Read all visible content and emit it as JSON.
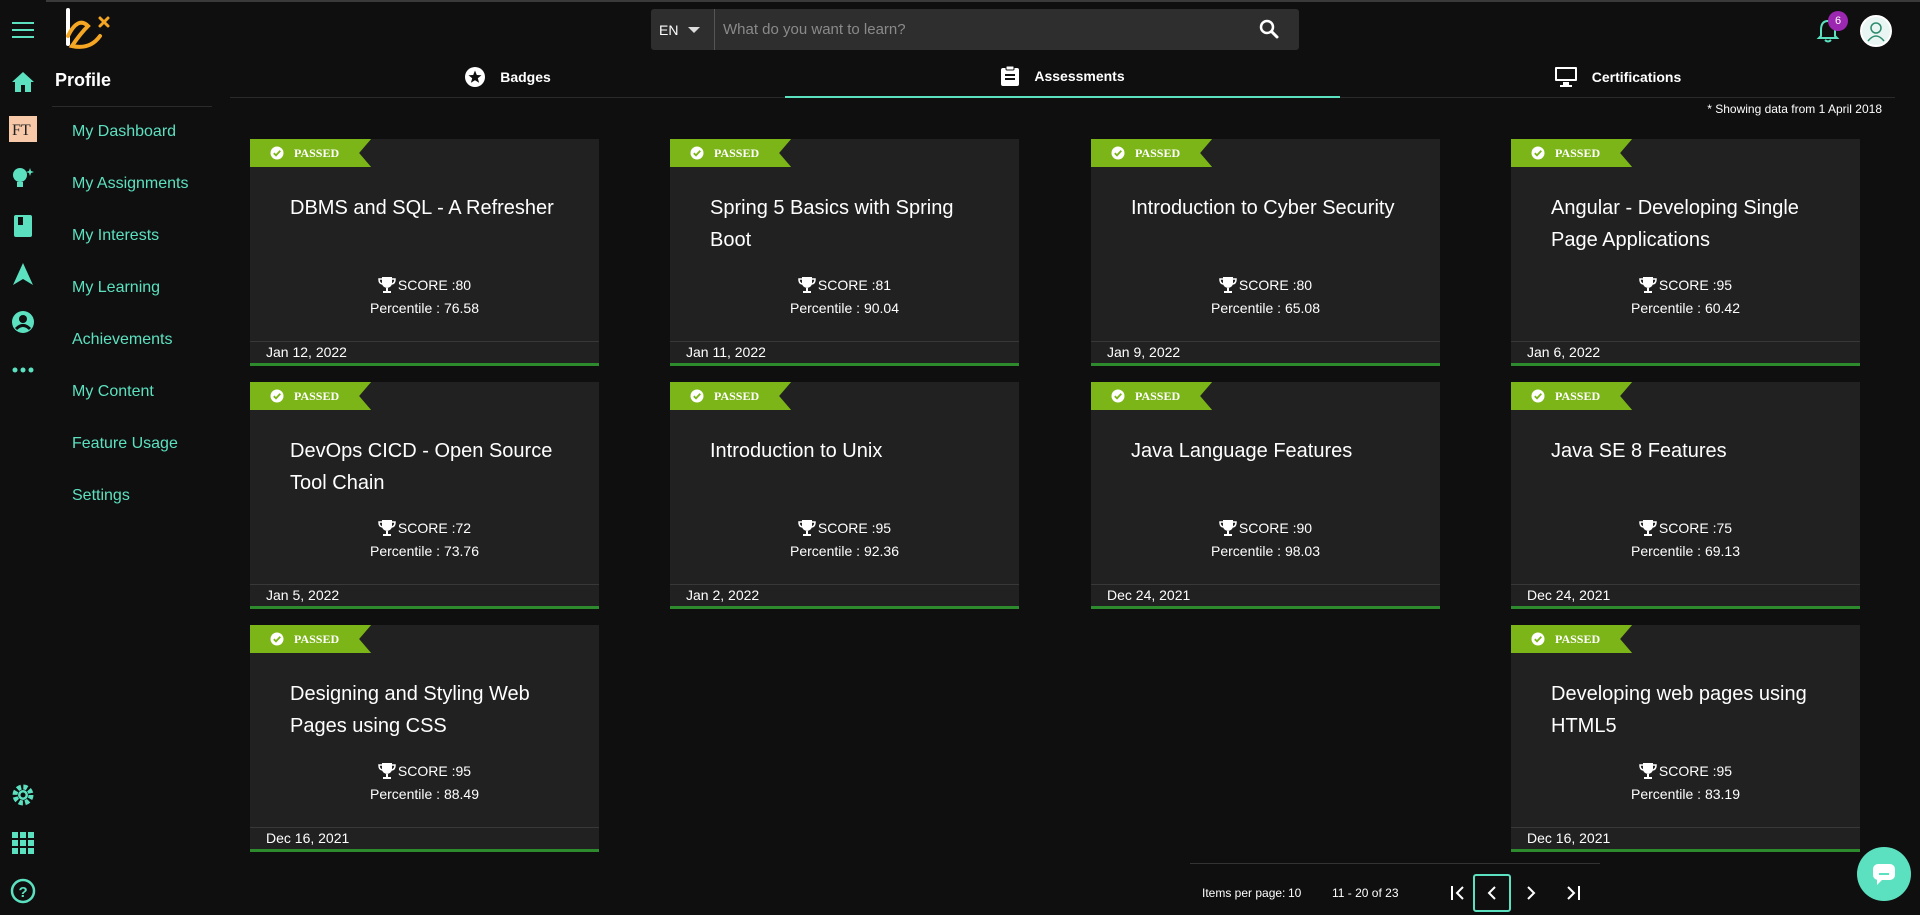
{
  "header": {
    "lang": "EN",
    "search_placeholder": "What do you want to learn?",
    "notifications_count": "6"
  },
  "sidebar": {
    "title": "Profile",
    "items": [
      "My Dashboard",
      "My Assignments",
      "My Interests",
      "My Learning",
      "Achievements",
      "My Content",
      "Feature Usage",
      "Settings"
    ],
    "rail_icons": [
      "menu-icon",
      "home-icon",
      "ft-logo-icon",
      "lightbulb-icon",
      "book-icon",
      "navigation-arrow-icon",
      "account-circle-icon",
      "more-horiz-icon",
      "settings-gear-icon",
      "apps-grid-icon",
      "help-icon"
    ]
  },
  "tabs": [
    {
      "label": "Badges",
      "icon": "star-circle-icon"
    },
    {
      "label": "Assessments",
      "icon": "clipboard-icon",
      "active": true
    },
    {
      "label": "Certifications",
      "icon": "monitor-icon"
    }
  ],
  "note": "* Showing data from 1 April 2018",
  "cards": [
    {
      "status": "PASSED",
      "title": "DBMS and SQL - A Refresher",
      "score": "SCORE :80",
      "percentile": "Percentile : 76.58",
      "date": "Jan 12, 2022"
    },
    {
      "status": "PASSED",
      "title": "Spring 5 Basics with Spring Boot",
      "score": "SCORE :81",
      "percentile": "Percentile : 90.04",
      "date": "Jan 11, 2022"
    },
    {
      "status": "PASSED",
      "title": "Introduction to Cyber Security",
      "score": "SCORE :80",
      "percentile": "Percentile : 65.08",
      "date": "Jan 9, 2022"
    },
    {
      "status": "PASSED",
      "title": "Angular - Developing Single Page Applications",
      "score": "SCORE :95",
      "percentile": "Percentile : 60.42",
      "date": "Jan 6, 2022"
    },
    {
      "status": "PASSED",
      "title": "DevOps CICD - Open Source Tool Chain",
      "score": "SCORE :72",
      "percentile": "Percentile : 73.76",
      "date": "Jan 5, 2022"
    },
    {
      "status": "PASSED",
      "title": "Introduction to Unix",
      "score": "SCORE :95",
      "percentile": "Percentile : 92.36",
      "date": "Jan 2, 2022"
    },
    {
      "status": "PASSED",
      "title": "Java Language Features",
      "score": "SCORE :90",
      "percentile": "Percentile : 98.03",
      "date": "Dec 24, 2021"
    },
    {
      "status": "PASSED",
      "title": "Java SE 8 Features",
      "score": "SCORE :75",
      "percentile": "Percentile : 69.13",
      "date": "Dec 24, 2021"
    },
    {
      "status": "PASSED",
      "title": "Designing and Styling Web Pages using CSS",
      "score": "SCORE :95",
      "percentile": "Percentile : 88.49",
      "date": "Dec 16, 2021"
    },
    {
      "status": "PASSED",
      "title": "Developing web pages using HTML5",
      "score": "SCORE :95",
      "percentile": "Percentile : 83.19",
      "date": "Dec 16, 2021"
    }
  ],
  "pagination": {
    "items_per_page_label": "Items per page:",
    "items_per_page": "10",
    "range": "11 - 20 of 23"
  },
  "colors": {
    "accent": "#5ce1c0",
    "passed": "#7cb518",
    "card_bg": "#212121",
    "bg": "#0f0f0f"
  }
}
